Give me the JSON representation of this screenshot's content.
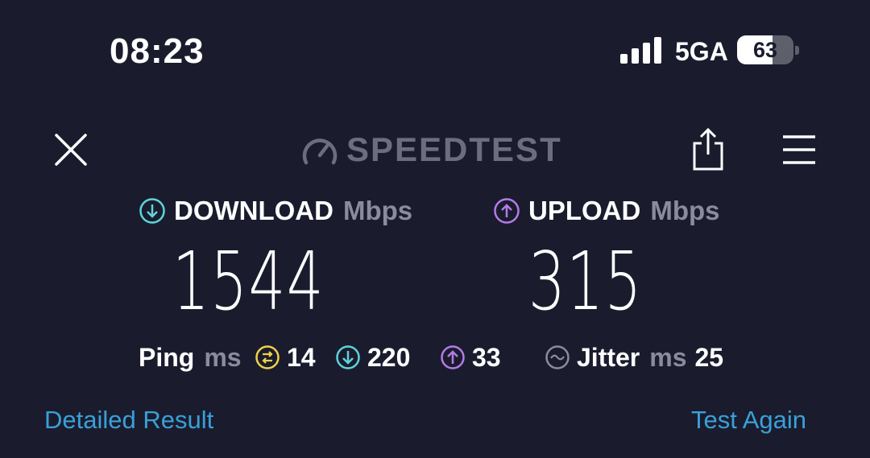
{
  "status_bar": {
    "time": "08:23",
    "network": "5GA",
    "battery_percent": "63",
    "battery_level": 0.63,
    "signal_bars": 4
  },
  "header": {
    "logo_text": "SPEEDTEST",
    "close_icon": "close-icon",
    "share_icon": "share-icon",
    "menu_icon": "hamburger-menu-icon"
  },
  "download": {
    "label": "DOWNLOAD",
    "unit": "Mbps",
    "value": "1544",
    "icon": "download-arrow-icon",
    "color": "#5fd4d8"
  },
  "upload": {
    "label": "UPLOAD",
    "unit": "Mbps",
    "value": "315",
    "icon": "upload-arrow-icon",
    "color": "#b47be6"
  },
  "stats": {
    "ping_label": "Ping",
    "ping_unit": "ms",
    "ping_idle": "14",
    "ping_idle_color": "#f0d24a",
    "ping_download": "220",
    "ping_upload": "33",
    "jitter_label": "Jitter",
    "jitter_unit": "ms",
    "jitter_value": "25"
  },
  "actions": {
    "detailed_result": "Detailed Result",
    "test_again": "Test Again",
    "link_color": "#3aa0d8"
  }
}
